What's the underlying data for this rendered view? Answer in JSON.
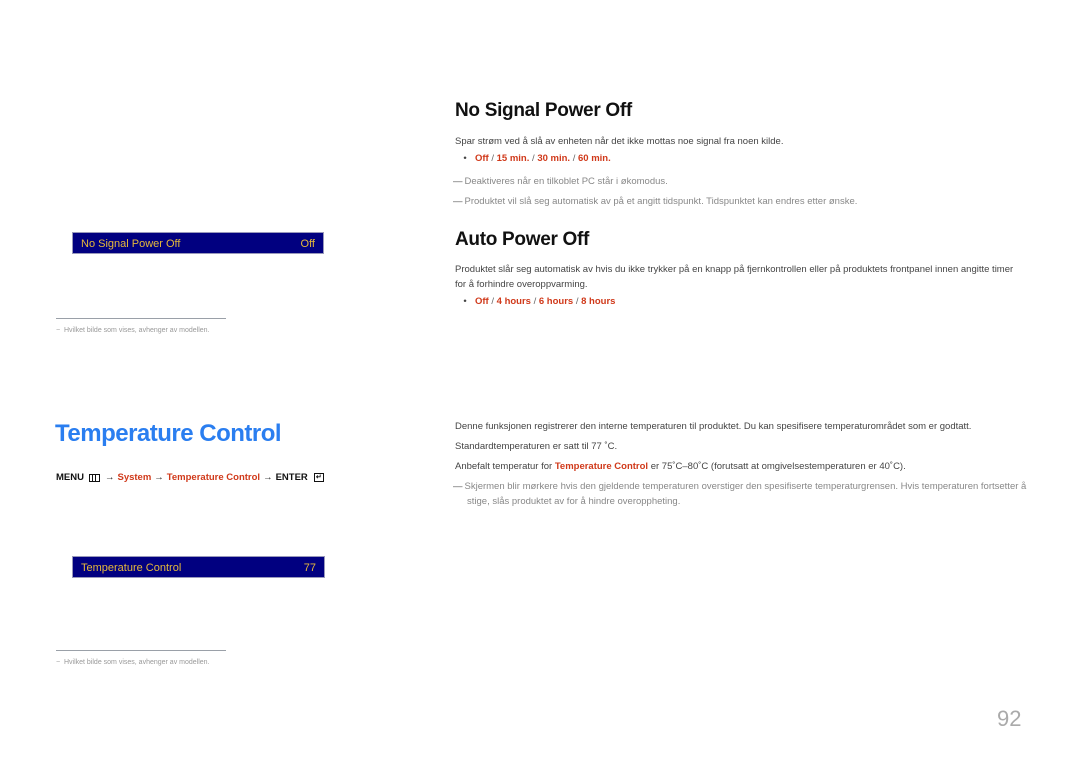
{
  "no_signal": {
    "title": "No Signal Power Off",
    "desc": "Spar strøm ved å slå av enheten når det ikke mottas noe signal fra noen kilde.",
    "options": [
      "Off",
      "15 min.",
      "30 min.",
      "60 min."
    ],
    "separator": " / ",
    "notes": [
      "Deaktiveres når en tilkoblet PC står i økomodus.",
      "Produktet vil slå seg automatisk av på et angitt tidspunkt. Tidspunktet kan endres etter ønske."
    ],
    "osd": {
      "label": "No Signal Power Off",
      "value": "Off"
    },
    "footnote": "Hvilket bilde som vises, avhenger av modellen."
  },
  "auto_power": {
    "title": "Auto Power Off",
    "desc": "Produktet slår seg automatisk av hvis du ikke trykker på en knapp på fjernkontrollen eller på produktets frontpanel innen angitte timer for å forhindre overoppvarming.",
    "options": [
      "Off",
      "4 hours",
      "6 hours",
      "8 hours"
    ]
  },
  "temperature": {
    "title": "Temperature Control",
    "menu_path": {
      "menu": "MENU",
      "arrow": "→",
      "system": "System",
      "item": "Temperature Control",
      "enter": "ENTER"
    },
    "osd": {
      "label": "Temperature Control",
      "value": "77"
    },
    "footnote": "Hvilket bilde som vises, avhenger av modellen.",
    "para1": "Denne funksjonen registrerer den interne temperaturen til produktet. Du kan spesifisere temperaturområdet som er godtatt.",
    "para2": "Standardtemperaturen er satt til 77 ˚C.",
    "para3_pre": "Anbefalt temperatur for ",
    "para3_bold": "Temperature Control",
    "para3_post": " er 75˚C–80˚C (forutsatt at omgivelsestemperaturen er 40˚C).",
    "note": "Skjermen blir mørkere hvis den gjeldende temperaturen overstiger den spesifiserte temperaturgrensen. Hvis temperaturen fortsetter å stige, slås produktet av for å hindre overoppheting."
  },
  "page_number": "92"
}
